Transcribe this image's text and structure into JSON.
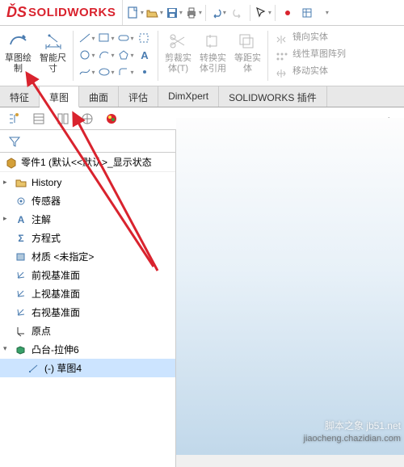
{
  "logo": {
    "ds": "ĎS",
    "text": "SOLIDWORKS"
  },
  "qat": {
    "items": [
      "new",
      "open",
      "save",
      "print",
      "undo",
      "redo",
      "select",
      "options",
      "rebuild"
    ]
  },
  "ribbon": {
    "sketch": {
      "label": "草图绘\n制"
    },
    "smartdim": {
      "label": "智能尺\n寸"
    },
    "trim": {
      "label": "剪裁实\n体(T)"
    },
    "convert": {
      "label": "转换实\n体引用"
    },
    "offset": {
      "label": "等距实\n体"
    },
    "right": {
      "mirror": "镜向实体",
      "pattern": "线性草图阵列",
      "move": "移动实体"
    }
  },
  "tabs": [
    {
      "label": "特征",
      "active": false
    },
    {
      "label": "草图",
      "active": true
    },
    {
      "label": "曲面",
      "active": false
    },
    {
      "label": "评估",
      "active": false
    },
    {
      "label": "DimXpert",
      "active": false
    },
    {
      "label": "SOLIDWORKS 插件",
      "active": false
    }
  ],
  "fm": {
    "part": "零件1  (默认<<默认>_显示状态",
    "history": "History",
    "sensors": "传感器",
    "annotations": "注解",
    "equations": "方程式",
    "material": "材质 <未指定>",
    "front": "前视基准面",
    "top": "上视基准面",
    "right": "右视基准面",
    "origin": "原点",
    "feature": "凸台-拉伸6",
    "sketch": "(-) 草图4"
  },
  "watermark": {
    "main": "脚本之象 jb51.net",
    "sub": "jiaocheng.chazidian.com"
  }
}
